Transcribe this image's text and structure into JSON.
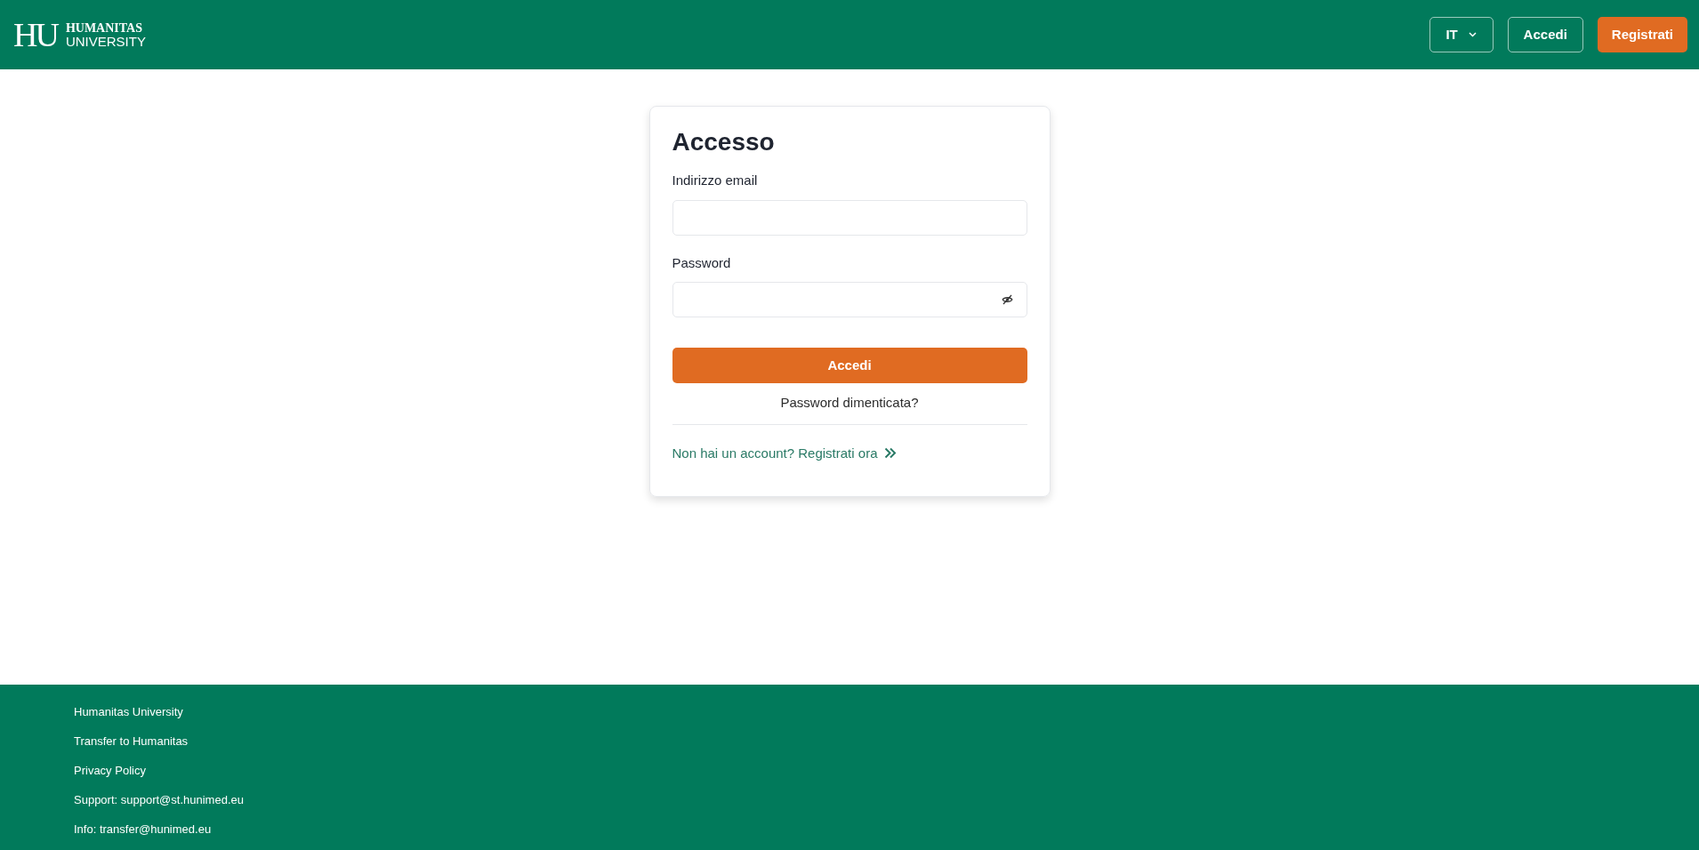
{
  "header": {
    "logo": {
      "mark": "HU",
      "line_1": "HUMANITAS",
      "line_2": "UNIVERSITY"
    },
    "language": "IT",
    "buttons": [
      {
        "label": "Accedi",
        "kind": "outline"
      },
      {
        "label": "Registrati",
        "kind": "filled"
      }
    ]
  },
  "login": {
    "title": "Accesso",
    "fields": [
      {
        "label": "Indirizzo email",
        "kind": "email"
      },
      {
        "label": "Password",
        "kind": "password"
      }
    ],
    "submit": "Accedi",
    "forgot": "Password dimenticata?",
    "register": "Non hai un account? Registrati ora"
  },
  "footer": {
    "links": [
      "Humanitas University",
      "Transfer to Humanitas",
      "Privacy Policy",
      "Support: support@st.hunimed.eu",
      "Info: transfer@hunimed.eu"
    ]
  }
}
